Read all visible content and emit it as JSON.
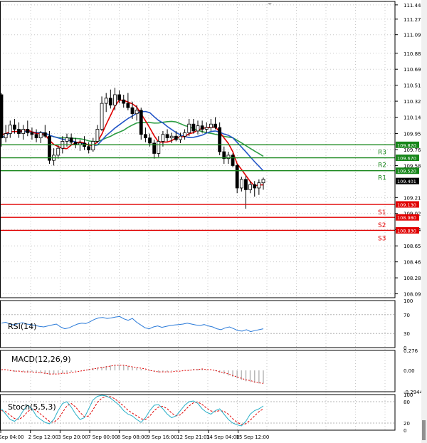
{
  "chart_data": {
    "type": "candlestick",
    "main": {
      "price_ticks": [
        "111.440",
        "111.275",
        "111.095",
        "110.880",
        "110.695",
        "110.510",
        "110.325",
        "110.140",
        "109.950",
        "109.765",
        "109.580",
        "109.210",
        "109.025",
        "108.840",
        "108.650",
        "108.465",
        "108.280",
        "108.095"
      ],
      "ylim": [
        108.05,
        111.48
      ],
      "last_price": "109.401",
      "levels": [
        {
          "name": "R3",
          "value": 109.82,
          "label": "109.820",
          "color": "#17861a"
        },
        {
          "name": "R2",
          "value": 109.67,
          "label": "109.670",
          "color": "#17861a"
        },
        {
          "name": "R1",
          "value": 109.52,
          "label": "109.520",
          "color": "#17861a"
        },
        {
          "name": "S1",
          "value": 109.13,
          "label": "109.130",
          "color": "#e00000"
        },
        {
          "name": "S2",
          "value": 108.98,
          "label": "108.980",
          "color": "#e00000"
        },
        {
          "name": "S3",
          "value": 108.83,
          "label": "108.830",
          "color": "#e00000"
        }
      ],
      "candles": [
        [
          110.4,
          110.42,
          109.8,
          109.9
        ],
        [
          109.9,
          110.05,
          109.85,
          109.95
        ],
        [
          109.95,
          110.1,
          109.9,
          110.05
        ],
        [
          110.05,
          110.12,
          109.95,
          110.0
        ],
        [
          110.0,
          110.08,
          109.9,
          109.95
        ],
        [
          109.95,
          110.05,
          109.88,
          110.0
        ],
        [
          110.0,
          110.1,
          109.92,
          109.96
        ],
        [
          109.96,
          110.02,
          109.88,
          109.94
        ],
        [
          109.94,
          110.0,
          109.85,
          109.9
        ],
        [
          109.9,
          109.98,
          109.84,
          109.96
        ],
        [
          109.96,
          110.05,
          109.9,
          109.92
        ],
        [
          109.92,
          109.98,
          109.6,
          109.64
        ],
        [
          109.64,
          109.78,
          109.58,
          109.7
        ],
        [
          109.7,
          109.82,
          109.66,
          109.78
        ],
        [
          109.78,
          109.92,
          109.72,
          109.86
        ],
        [
          109.86,
          109.95,
          109.8,
          109.9
        ],
        [
          109.9,
          109.95,
          109.82,
          109.85
        ],
        [
          109.85,
          109.9,
          109.78,
          109.82
        ],
        [
          109.82,
          109.88,
          109.75,
          109.84
        ],
        [
          109.84,
          109.92,
          109.76,
          109.8
        ],
        [
          109.8,
          109.85,
          109.72,
          109.76
        ],
        [
          109.76,
          109.9,
          109.74,
          109.86
        ],
        [
          109.86,
          110.05,
          109.84,
          110.0
        ],
        [
          110.0,
          110.38,
          109.98,
          110.3
        ],
        [
          110.3,
          110.42,
          110.2,
          110.36
        ],
        [
          110.36,
          110.46,
          110.24,
          110.28
        ],
        [
          110.28,
          110.48,
          110.22,
          110.4
        ],
        [
          110.4,
          110.45,
          110.3,
          110.34
        ],
        [
          110.34,
          110.4,
          110.25,
          110.3
        ],
        [
          110.3,
          110.42,
          110.22,
          110.25
        ],
        [
          110.25,
          110.32,
          110.12,
          110.18
        ],
        [
          110.18,
          110.28,
          110.1,
          110.22
        ],
        [
          110.22,
          110.25,
          109.88,
          109.94
        ],
        [
          109.94,
          110.02,
          109.85,
          109.9
        ],
        [
          109.9,
          109.95,
          109.8,
          109.84
        ],
        [
          109.84,
          109.88,
          109.66,
          109.72
        ],
        [
          109.72,
          109.92,
          109.68,
          109.86
        ],
        [
          109.86,
          109.98,
          109.8,
          109.94
        ],
        [
          109.94,
          110.0,
          109.86,
          109.9
        ],
        [
          109.9,
          109.96,
          109.84,
          109.92
        ],
        [
          109.92,
          109.98,
          109.86,
          109.88
        ],
        [
          109.88,
          109.96,
          109.84,
          109.92
        ],
        [
          109.92,
          110.0,
          109.88,
          109.96
        ],
        [
          109.96,
          110.12,
          109.92,
          110.06
        ],
        [
          110.06,
          110.12,
          109.95,
          109.98
        ],
        [
          109.98,
          110.1,
          109.94,
          110.04
        ],
        [
          110.04,
          110.1,
          109.96,
          110.0
        ],
        [
          110.0,
          110.08,
          109.96,
          110.02
        ],
        [
          110.02,
          110.12,
          109.98,
          110.06
        ],
        [
          110.06,
          110.14,
          110.0,
          110.02
        ],
        [
          110.02,
          110.08,
          109.7,
          109.74
        ],
        [
          109.74,
          109.8,
          109.6,
          109.66
        ],
        [
          109.66,
          109.74,
          109.6,
          109.7
        ],
        [
          109.7,
          109.72,
          109.56,
          109.58
        ],
        [
          109.58,
          109.6,
          109.26,
          109.32
        ],
        [
          109.32,
          109.45,
          109.28,
          109.42
        ],
        [
          109.42,
          109.46,
          109.08,
          109.3
        ],
        [
          109.3,
          109.4,
          109.26,
          109.36
        ],
        [
          109.36,
          109.4,
          109.22,
          109.32
        ],
        [
          109.32,
          109.42,
          109.24,
          109.38
        ],
        [
          109.38,
          109.44,
          109.3,
          109.42
        ]
      ],
      "ma_fast_color": "#e00000",
      "ma_mid_color": "#2456c8",
      "ma_slow_color": "#2e9e44"
    },
    "x_labels": [
      "Sep 04:00",
      "2 Sep 12:00",
      "3 Sep 20:00",
      "7 Sep 00:00",
      "8 Sep 08:00",
      "9 Sep 16:00",
      "12 Sep 21:01",
      "14 Sep 04:00",
      "15 Sep 12:00"
    ],
    "rsi": {
      "label": "RSI(14)",
      "ticks": [
        "100",
        "70",
        "30",
        "0"
      ],
      "levels": [
        70,
        30
      ],
      "values": [
        52,
        54,
        50,
        48,
        51,
        53,
        50,
        49,
        47,
        45,
        44,
        46,
        48,
        50,
        44,
        40,
        42,
        46,
        50,
        52,
        51,
        55,
        60,
        63,
        64,
        62,
        63,
        65,
        66,
        61,
        58,
        62,
        54,
        48,
        42,
        40,
        44,
        46,
        43,
        45,
        47,
        48,
        49,
        50,
        52,
        50,
        48,
        47,
        49,
        46,
        44,
        40,
        38,
        42,
        44,
        40,
        36,
        35,
        38,
        34,
        36,
        38,
        40
      ]
    },
    "macd": {
      "label": "MACD(12,26,9)",
      "ticks": [
        "0.276",
        "0.00",
        "-0.2944"
      ],
      "ylim": [
        -0.2944,
        0.276
      ],
      "hist": [
        0.01,
        0.0,
        -0.01,
        -0.02,
        -0.01,
        -0.02,
        -0.03,
        -0.02,
        -0.03,
        -0.04,
        -0.05,
        -0.06,
        -0.05,
        -0.04,
        -0.04,
        -0.03,
        -0.02,
        -0.01,
        0.0,
        0.01,
        0.02,
        0.03,
        0.04,
        0.05,
        0.06,
        0.07,
        0.08,
        0.08,
        0.07,
        0.06,
        0.05,
        0.04,
        0.02,
        0.01,
        -0.01,
        -0.02,
        -0.03,
        -0.02,
        -0.02,
        -0.01,
        -0.01,
        0.0,
        0.0,
        0.01,
        0.02,
        0.02,
        0.02,
        0.01,
        0.0,
        -0.01,
        -0.03,
        -0.05,
        -0.07,
        -0.09,
        -0.11,
        -0.13,
        -0.15,
        -0.16,
        -0.17,
        -0.18,
        -0.18
      ],
      "signal": [
        0.01,
        0.01,
        0.0,
        -0.01,
        -0.01,
        -0.02,
        -0.02,
        -0.02,
        -0.03,
        -0.03,
        -0.04,
        -0.05,
        -0.05,
        -0.05,
        -0.04,
        -0.04,
        -0.03,
        -0.02,
        -0.01,
        0.0,
        0.01,
        0.02,
        0.03,
        0.04,
        0.05,
        0.06,
        0.07,
        0.07,
        0.07,
        0.06,
        0.05,
        0.04,
        0.03,
        0.02,
        0.0,
        -0.01,
        -0.02,
        -0.02,
        -0.02,
        -0.02,
        -0.01,
        -0.01,
        0.0,
        0.0,
        0.01,
        0.01,
        0.02,
        0.01,
        0.01,
        0.0,
        -0.02,
        -0.03,
        -0.05,
        -0.07,
        -0.09,
        -0.11,
        -0.13,
        -0.14,
        -0.16,
        -0.17,
        -0.18
      ]
    },
    "stoch": {
      "label": "Stoch(5,5,3)",
      "ticks": [
        "100",
        "80",
        "20",
        "0"
      ],
      "levels": [
        80,
        20
      ],
      "main_color": "#2ab0c8",
      "signal_color": "#e00000",
      "k": [
        60,
        45,
        30,
        25,
        35,
        55,
        70,
        60,
        40,
        30,
        22,
        18,
        30,
        55,
        75,
        80,
        65,
        45,
        30,
        35,
        60,
        85,
        95,
        98,
        96,
        90,
        80,
        70,
        55,
        45,
        40,
        30,
        22,
        35,
        55,
        70,
        72,
        60,
        45,
        35,
        40,
        55,
        70,
        80,
        82,
        75,
        60,
        50,
        45,
        55,
        60,
        45,
        30,
        20,
        15,
        12,
        25,
        45,
        55,
        60,
        68
      ],
      "d": [
        55,
        52,
        42,
        33,
        30,
        38,
        52,
        60,
        55,
        45,
        35,
        25,
        22,
        32,
        50,
        68,
        75,
        65,
        50,
        38,
        40,
        58,
        78,
        90,
        95,
        94,
        88,
        78,
        68,
        56,
        48,
        40,
        32,
        30,
        40,
        55,
        65,
        67,
        60,
        48,
        40,
        43,
        55,
        68,
        77,
        79,
        72,
        62,
        54,
        52,
        55,
        53,
        45,
        32,
        22,
        16,
        18,
        28,
        40,
        52,
        60
      ]
    }
  }
}
